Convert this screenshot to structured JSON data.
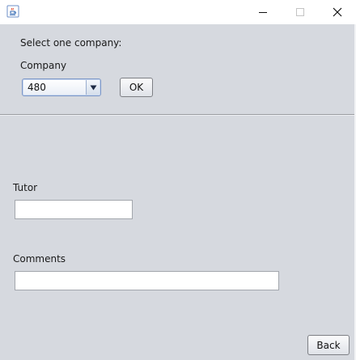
{
  "window": {
    "controls": {
      "minimize_icon": "minimize-icon",
      "maximize_icon": "maximize-icon",
      "close_icon": "close-icon"
    },
    "app_icon": "java-coffee-cup-icon"
  },
  "company_section": {
    "prompt": "Select one company:",
    "company_label": "Company",
    "selected_company": "480",
    "ok_label": "OK"
  },
  "details": {
    "tutor_label": "Tutor",
    "tutor_value": "",
    "comments_label": "Comments",
    "comments_value": ""
  },
  "footer": {
    "back_label": "Back"
  },
  "colors": {
    "panel_background": "#d6d9df",
    "titlebar_background": "#ffffff",
    "combo_border": "#7b96c7"
  }
}
